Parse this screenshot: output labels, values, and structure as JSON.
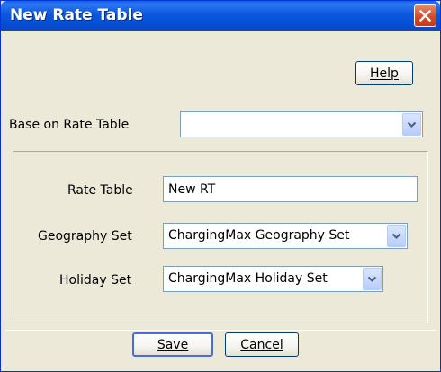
{
  "window": {
    "title": "New Rate Table",
    "close_icon": "close-icon"
  },
  "toolbar": {
    "help_label": "Help"
  },
  "base": {
    "label": "Base on Rate Table",
    "value": ""
  },
  "form": {
    "rate_table_label": "Rate Table",
    "rate_table_value": "New RT",
    "geography_label": "Geography Set",
    "geography_value": "ChargingMax Geography Set",
    "holiday_label": "Holiday Set",
    "holiday_value": "ChargingMax Holiday Set"
  },
  "footer": {
    "save_label": "Save",
    "cancel_label": "Cancel"
  },
  "colors": {
    "titlebar": "#0a5ee8",
    "window_bg": "#ece9d8",
    "close": "#d9472a",
    "input_border": "#7f9db9"
  }
}
